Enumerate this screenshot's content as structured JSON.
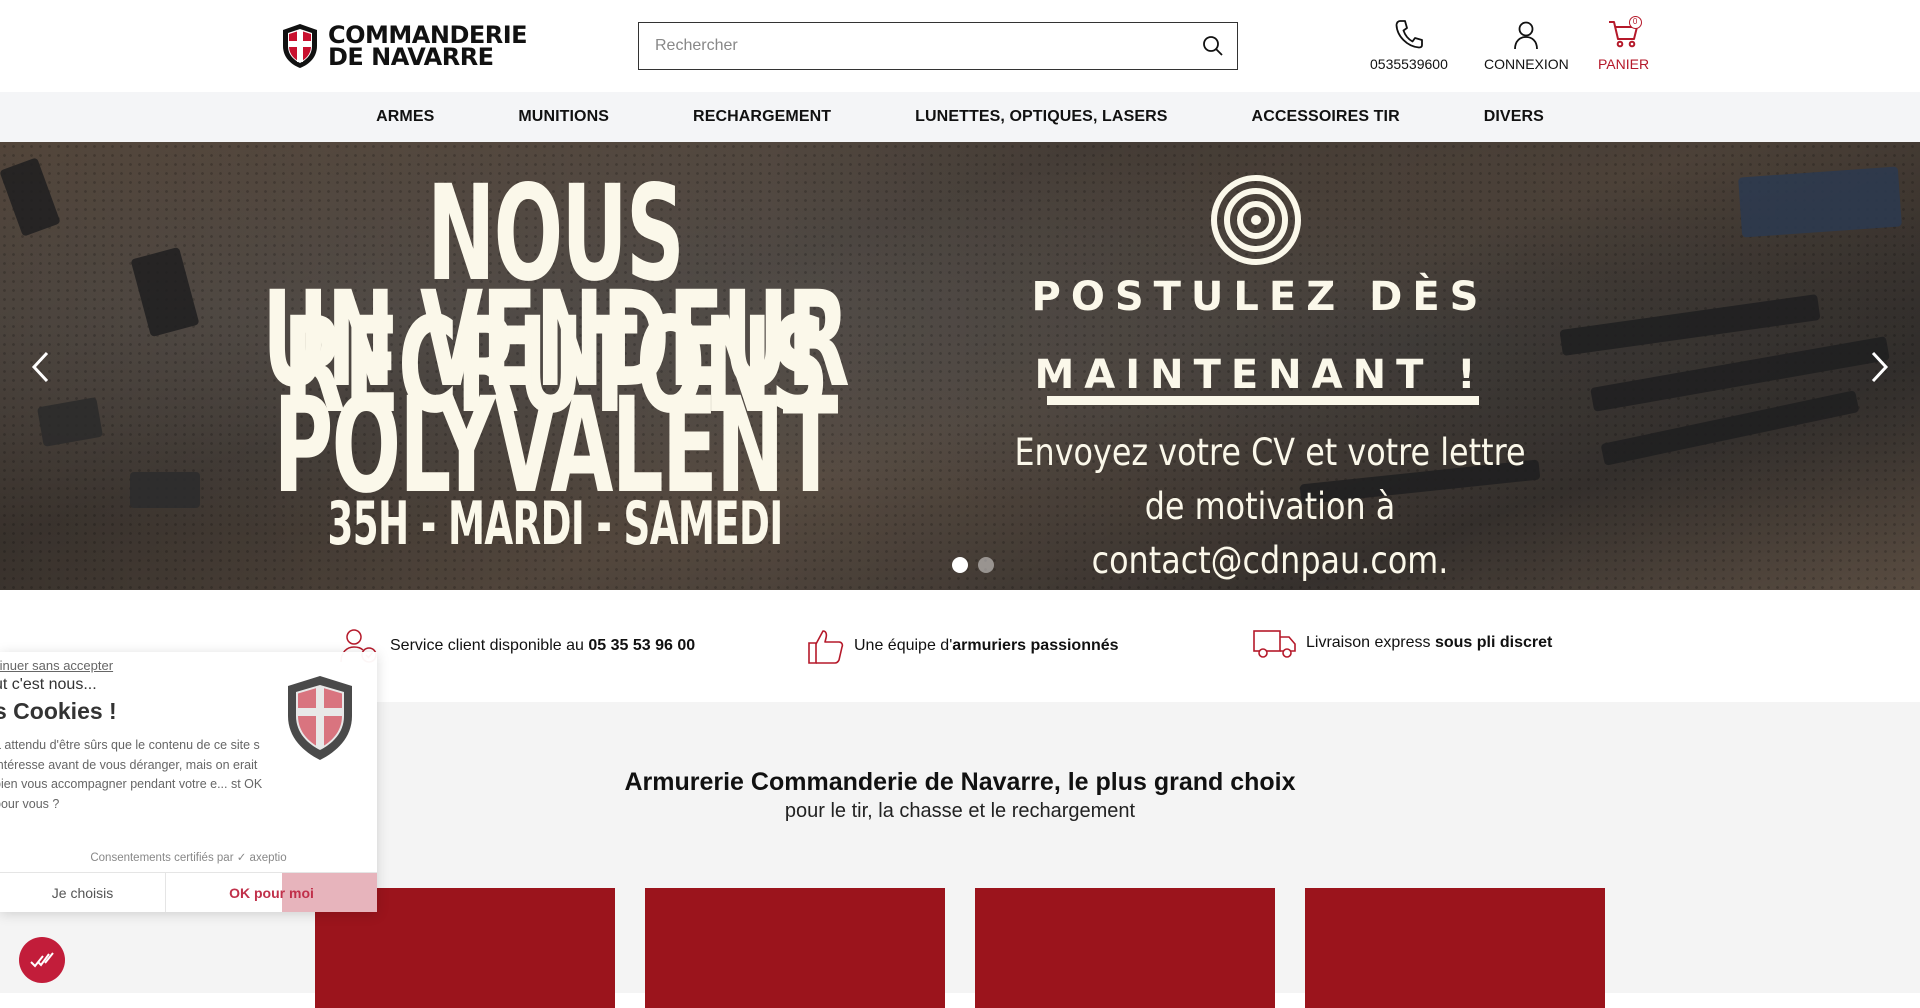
{
  "header": {
    "logo_line1": "COMMANDERIE",
    "logo_line2": "DE NAVARRE",
    "search_placeholder": "Rechercher",
    "phone_label": "0535539600",
    "login_label": "CONNEXION",
    "cart_label": "PANIER",
    "cart_count": "0",
    "brand_color": "#b5192a"
  },
  "nav": {
    "items": [
      "ARMES",
      "MUNITIONS",
      "RECHARGEMENT",
      "LUNETTES, OPTIQUES, LASERS",
      "ACCESSOIRES TIR",
      "DIVERS"
    ]
  },
  "hero": {
    "line1": "NOUS RECRUTONS",
    "line2": "UN VENDEUR",
    "line3": "POLYVALENT",
    "line4": "35H - MARDI - SAMEDI",
    "cta1": "POSTULEZ DÈS",
    "cta2": "MAINTENANT !",
    "sub": "Envoyez votre CV et votre lettre de motivation à contact@cdnpau.com.",
    "slides_total": 2,
    "active_slide": 1
  },
  "reassurance": {
    "r1_text": "Service client disponible au ",
    "r1_bold": "05 35 53 96 00",
    "r2_text": "Une équipe d'",
    "r2_bold": "armuriers passionnés",
    "r3_text": "Livraison express ",
    "r3_bold": "sous pli discret"
  },
  "section": {
    "title": "Armurerie Commanderie de Navarre, le plus grand choix",
    "subtitle": "pour le tir, la chasse et le rechargement",
    "card_color": "#9b141c"
  },
  "cookie": {
    "skip": "tinuer sans accepter",
    "pre": "ut c'est nous...",
    "title": "s Cookies !",
    "body": "a attendu d'être sûrs que le contenu de ce site s intéresse avant de vous déranger, mais on erait bien vous accompagner pendant votre e... st OK pour vous ?",
    "cert": "Consentements certifiés par ✓ axeptio",
    "choose": "Je choisis",
    "ok": "OK pour moi",
    "accent": "#c21d3a"
  }
}
